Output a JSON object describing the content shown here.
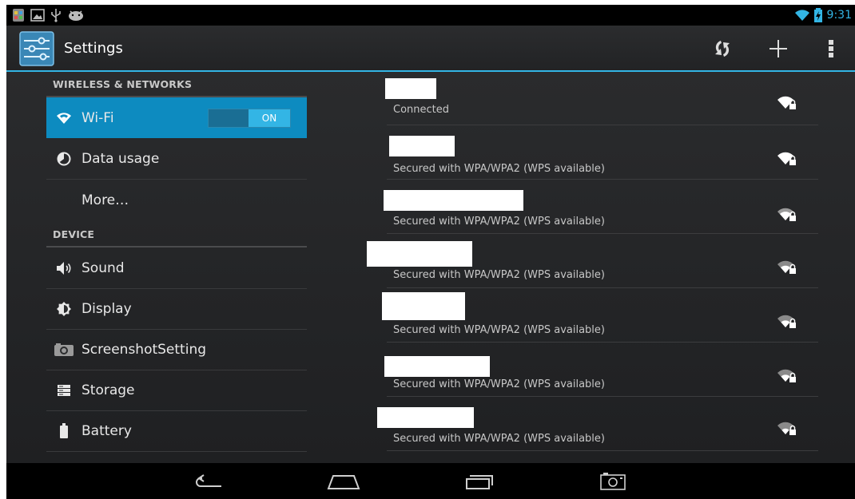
{
  "status_bar": {
    "time": "9:31",
    "left_icons": [
      "notification-app-icon",
      "image-icon",
      "usb-icon",
      "android-debug-icon"
    ],
    "right_icons": [
      "wifi-icon",
      "battery-charging-icon"
    ]
  },
  "action_bar": {
    "title": "Settings",
    "actions": [
      "wps-icon",
      "add-icon",
      "overflow-menu-icon"
    ]
  },
  "settings": {
    "sections": [
      {
        "header": "WIRELESS & NETWORKS"
      },
      {
        "header": "DEVICE"
      }
    ],
    "items": [
      {
        "label": "Wi-Fi",
        "icon": "wifi-icon",
        "selected": true
      },
      {
        "label": "Data usage",
        "icon": "data-usage-icon"
      },
      {
        "label": "More…",
        "icon": ""
      },
      {
        "label": "Sound",
        "icon": "speaker-icon"
      },
      {
        "label": "Display",
        "icon": "brightness-icon"
      },
      {
        "label": "ScreenshotSetting",
        "icon": "camera-icon"
      },
      {
        "label": "Storage",
        "icon": "storage-icon"
      },
      {
        "label": "Battery",
        "icon": "battery-icon"
      }
    ],
    "wifi_toggle": "ON"
  },
  "networks": [
    {
      "status": "Connected",
      "signal": "wifi-lock-icon"
    },
    {
      "status": "Secured with WPA/WPA2 (WPS available)",
      "signal": "wifi-lock-icon"
    },
    {
      "status": "Secured with WPA/WPA2 (WPS available)",
      "signal": "wifi-lock-icon"
    },
    {
      "status": "Secured with WPA/WPA2 (WPS available)",
      "signal": "wifi-lock-icon"
    },
    {
      "status": "Secured with WPA/WPA2 (WPS available)",
      "signal": "wifi-lock-icon"
    },
    {
      "status": "Secured with WPA/WPA2 (WPS available)",
      "signal": "wifi-lock-icon"
    },
    {
      "status": "Secured with WPA/WPA2 (WPS available)",
      "signal": "wifi-lock-icon"
    }
  ],
  "nav_bar": {
    "buttons": [
      "back-icon",
      "home-icon",
      "recent-apps-icon",
      "screenshot-icon"
    ]
  },
  "colors": {
    "accent": "#33b5e5",
    "selected": "#0d8bc0",
    "background": "#1d1d1d"
  }
}
